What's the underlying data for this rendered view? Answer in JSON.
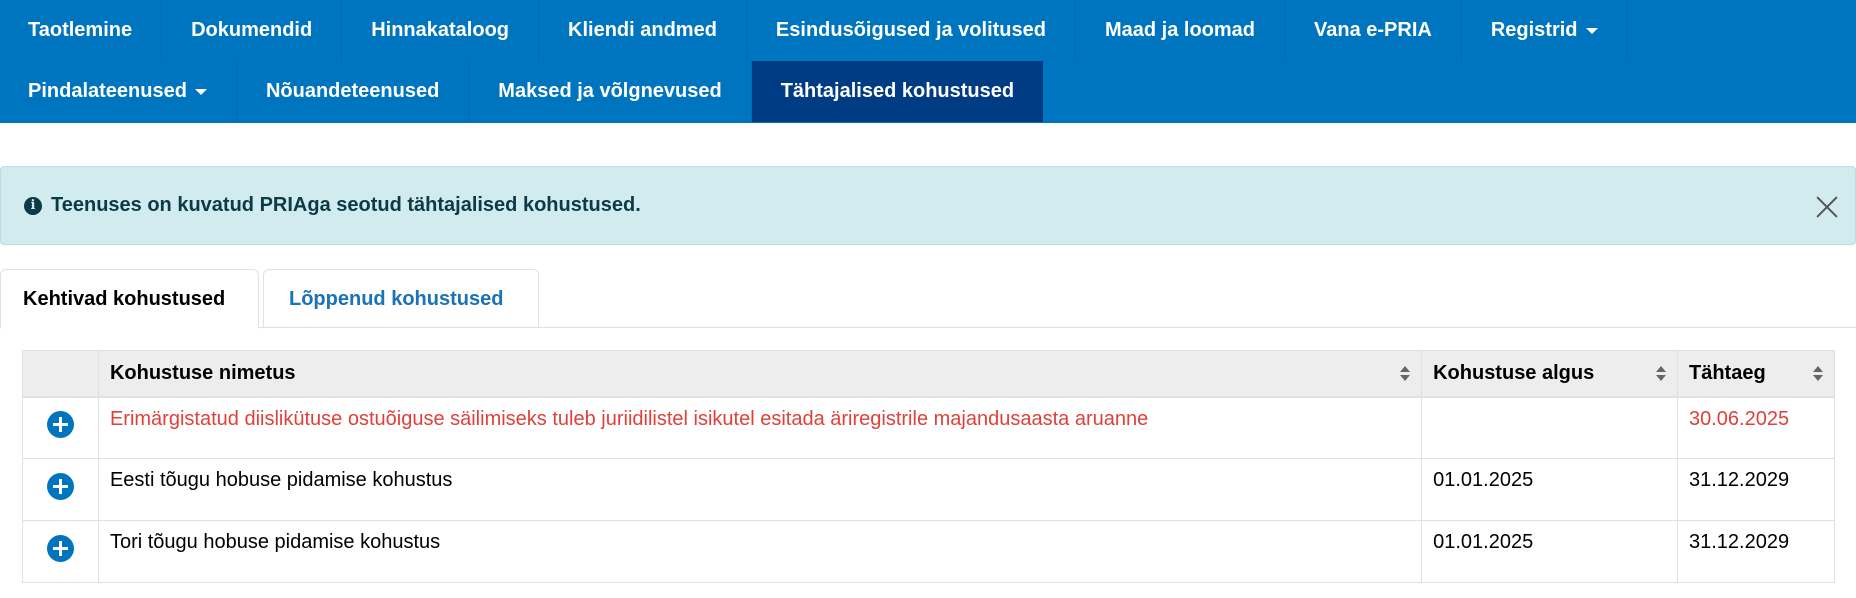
{
  "nav": {
    "row1": [
      {
        "label": "Taotlemine"
      },
      {
        "label": "Dokumendid"
      },
      {
        "label": "Hinnakataloog"
      },
      {
        "label": "Kliendi andmed"
      },
      {
        "label": "Esindusõigused ja volitused"
      },
      {
        "label": "Maad ja loomad"
      },
      {
        "label": "Vana e-PRIA"
      },
      {
        "label": "Registrid"
      }
    ],
    "row2": [
      {
        "label": "Pindalateenused"
      },
      {
        "label": "Nõuandeteenused"
      },
      {
        "label": "Maksed ja võlgnevused"
      },
      {
        "label": "Tähtajalised kohustused"
      }
    ],
    "active": "Tähtajalised kohustused",
    "color": "#0075bf",
    "active_color": "#003c84"
  },
  "alert": {
    "icon": "info-circle-icon",
    "text": "Teenuses on kuvatud PRIAga seotud tähtajalised kohustused."
  },
  "tabs": [
    {
      "label": "Kehtivad kohustused",
      "active": true
    },
    {
      "label": "Lõppenud kohustused",
      "active": false
    }
  ],
  "table": {
    "columns": [
      "",
      "Kohustuse nimetus",
      "Kohustuse algus",
      "Tähtaeg"
    ],
    "rows": [
      {
        "name": "Erimärgistatud diislikütuse ostuõiguse säilimiseks tuleb juriidilistel isikutel esitada äriregistrile majandusaasta aruanne",
        "start": "",
        "due": "30.06.2025",
        "overdue": true
      },
      {
        "name": "Eesti tõugu hobuse pidamise kohustus",
        "start": "01.01.2025",
        "due": "31.12.2029",
        "overdue": false
      },
      {
        "name": "Tori tõugu hobuse pidamise kohustus",
        "start": "01.01.2025",
        "due": "31.12.2029",
        "overdue": false
      }
    ],
    "overdue_color": "#e0403a"
  }
}
